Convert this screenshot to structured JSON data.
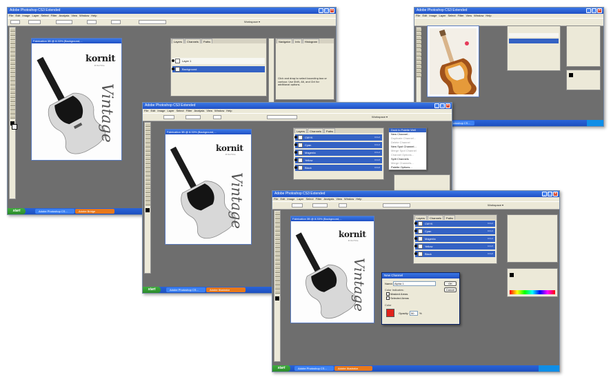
{
  "app": {
    "menu": [
      "File",
      "Edit",
      "Image",
      "Layer",
      "Select",
      "Filter",
      "Analysis",
      "View",
      "Window",
      "Help"
    ],
    "start_label": "start",
    "workspace_label": "Workspace ▾"
  },
  "windows": {
    "top_left": {
      "title": "Adobe Photoshop CS3 Extended",
      "doc_title": "Fabrication 3B @ 8.33% (Background,...",
      "panel_tabs": [
        "Layers",
        "Channels",
        "Paths"
      ],
      "layers": [
        "Layer 1",
        "Background"
      ],
      "info_tabs": [
        "Navigator",
        "Info",
        "Histogram"
      ],
      "info_text": "Click and drag to select bounding box or contour. Use Shift, Alt, and Ctrl for additional options.",
      "taskbar": [
        "Adobe Photoshop CS...",
        "Adobe Bridge"
      ]
    },
    "top_right": {
      "title": "Adobe Photoshop CS3 Extended",
      "taskbar": [
        "Adobe Photoshop CS..."
      ]
    },
    "middle": {
      "title": "Adobe Photoshop CS3 Extended",
      "doc_title": "Fabrication 3B @ 8.33% (Background,...",
      "panel_tabs": [
        "Layers",
        "Channels",
        "Paths"
      ],
      "channels": [
        {
          "name": "CMYK",
          "shortcut": "Ctrl+2"
        },
        {
          "name": "Cyan",
          "shortcut": "Ctrl+3"
        },
        {
          "name": "Magenta",
          "shortcut": "Ctrl+4"
        },
        {
          "name": "Yellow",
          "shortcut": "Ctrl+5"
        },
        {
          "name": "Black",
          "shortcut": "Ctrl+6"
        }
      ],
      "panel_menu": [
        "Dock to Palette Well",
        "New Channel...",
        "Duplicate Channel...",
        "Delete Channel",
        "New Spot Channel...",
        "Merge Spot Channel",
        "Channel Options...",
        "Split Channels",
        "Merge Channels...",
        "Palette Options..."
      ],
      "taskbar": [
        "Adobe Photoshop CS...",
        "Adobe Illustrator"
      ]
    },
    "bottom": {
      "title": "Adobe Photoshop CS3 Extended",
      "doc_title": "Fabrication 3B @ 8.33% (Background,...",
      "panel_tabs": [
        "Layers",
        "Channels",
        "Paths"
      ],
      "channels": [
        {
          "name": "CMYK",
          "shortcut": "Ctrl+2"
        },
        {
          "name": "Cyan",
          "shortcut": "Ctrl+3"
        },
        {
          "name": "Magenta",
          "shortcut": "Ctrl+4"
        },
        {
          "name": "Yellow",
          "shortcut": "Ctrl+5"
        },
        {
          "name": "Black",
          "shortcut": "Ctrl+6"
        }
      ],
      "dialog": {
        "title": "New Channel",
        "name_label": "Name:",
        "name_value": "Alpha 1",
        "ok_label": "OK",
        "cancel_label": "Cancel",
        "indicates_label": "Color Indicates:",
        "option_masked": "Masked Areas",
        "option_selected": "Selected Areas",
        "color_label": "Color",
        "opacity_label": "Opacity:",
        "opacity_value": "50",
        "percent_sign": "%",
        "swatch_color": "#e0231c"
      },
      "taskbar": [
        "Adobe Photoshop CS...",
        "Adobe Illustrator"
      ]
    }
  },
  "artwork": {
    "brand": "kornit",
    "brand_sub": "DIGITAL",
    "script_text": "Vintage"
  },
  "colors": {
    "xp_blue": "#1f4fc4",
    "selection_blue": "#3462c4",
    "canvas_gray": "#6e6e6e",
    "guitar_sunburst": "#a0521b"
  }
}
